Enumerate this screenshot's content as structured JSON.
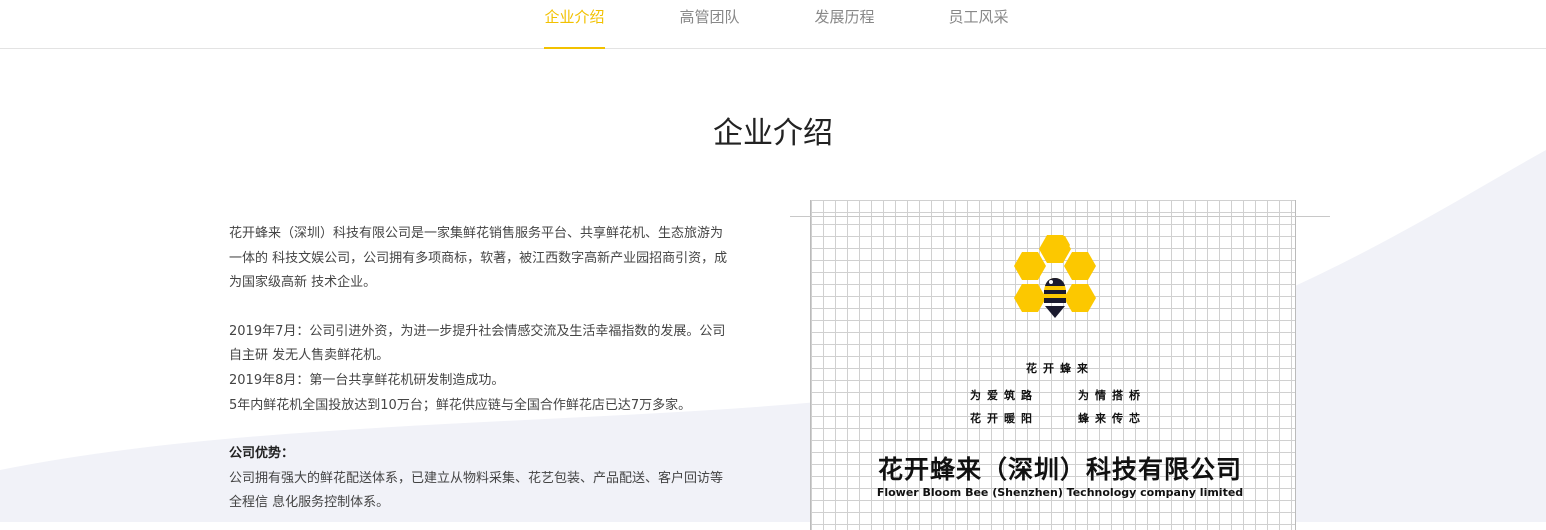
{
  "nav": {
    "tabs": [
      {
        "label": "企业介绍",
        "active": true
      },
      {
        "label": "高管团队",
        "active": false
      },
      {
        "label": "发展历程",
        "active": false
      },
      {
        "label": "员工风采",
        "active": false
      }
    ]
  },
  "page_title": "企业介绍",
  "intro": {
    "para1_line1": "花开蜂来（深圳）科技有限公司是一家集鲜花销售服务平台、共享鲜花机、生态旅游为",
    "para1_line2": "一体的 科技文娱公司，公司拥有多项商标，软著，被江西数字高新产业园招商引资，成",
    "para1_line3": "为国家级高新 技术企业。",
    "milestone1_line1": "2019年7月：公司引进外资，为进一步提升社会情感交流及生活幸福指数的发展。公司",
    "milestone1_line2": "自主研 发无人售卖鲜花机。",
    "milestone2": "2019年8月：第一台共享鲜花机研发制造成功。",
    "milestone3": "5年内鲜花机全国投放达到10万台；鲜花供应链与全国合作鲜花店已达7万多家。",
    "advantage_heading": "公司优势：",
    "advantage_line1": "公司拥有强大的鲜花配送体系，已建立从物料采集、花艺包装、产品配送、客户回访等",
    "advantage_line2": "全程信 息化服务控制体系。"
  },
  "logo": {
    "name": "花开蜂来",
    "slogan_left_1": "为爱筑路",
    "slogan_left_2": "花开暖阳",
    "slogan_right_1": "为情搭桥",
    "slogan_right_2": "蜂来传芯",
    "company_cn": "花开蜂来（深圳）科技有限公司",
    "company_en": "Flower Bloom Bee (Shenzhen) Technology company limited",
    "icon": "honeycomb-bee-icon"
  },
  "colors": {
    "accent": "#f2c100",
    "hex_yellow": "#fcc800",
    "bee_dark": "#1a1a2e"
  }
}
